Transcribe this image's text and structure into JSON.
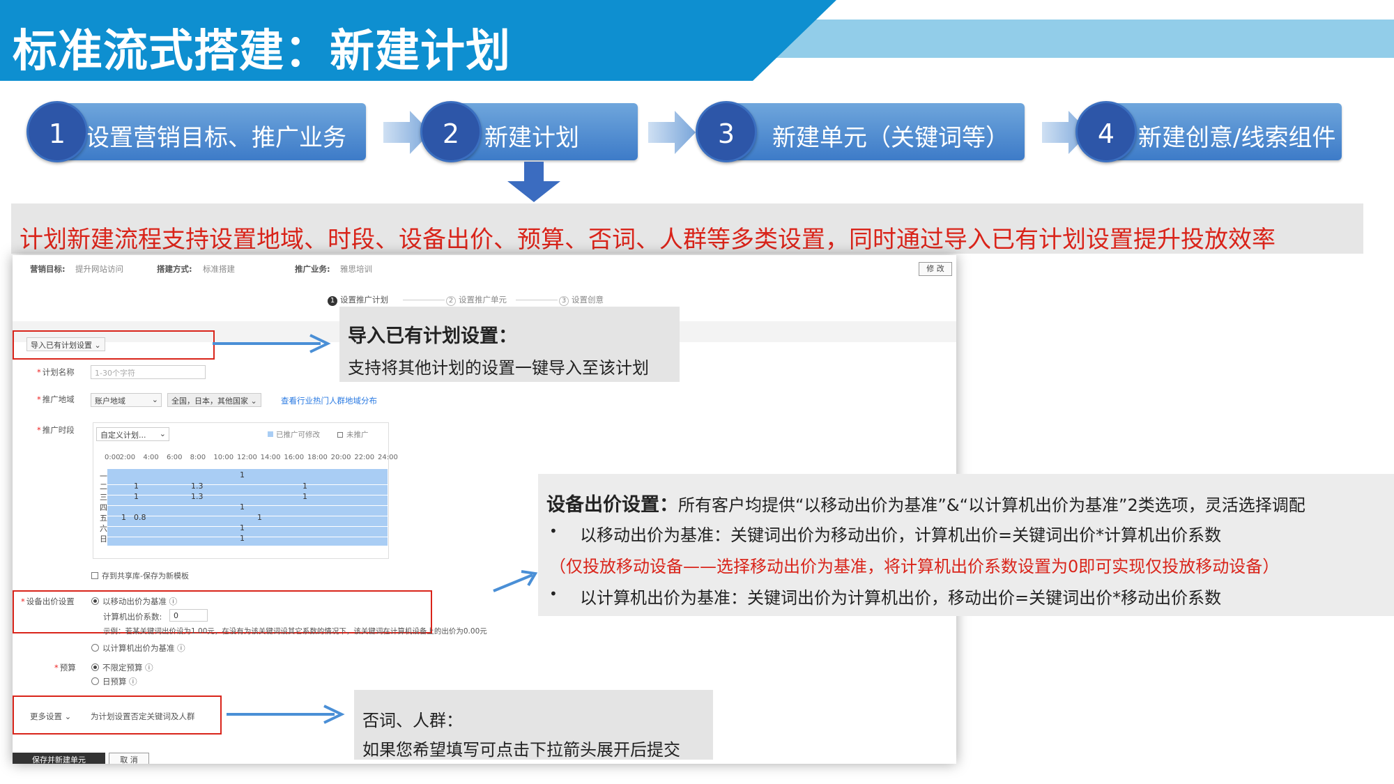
{
  "header": {
    "title": "标准流式搭建：新建计划"
  },
  "steps": [
    {
      "number": "1",
      "label": "设置营销目标、推广业务"
    },
    {
      "number": "2",
      "label": "新建计划"
    },
    {
      "number": "3",
      "label": "新建单元（关键词等）"
    },
    {
      "number": "4",
      "label": "新建创意/线索组件"
    }
  ],
  "summary": "计划新建流程支持设置地域、时段、设备出价、预算、否词、人群等多类设置，同时通过导入已有计划设置提升投放效率",
  "screenshot": {
    "marketing_goal_label": "营销目标:",
    "marketing_goal_value": "提升网站访问",
    "build_mode_label": "搭建方式:",
    "build_mode_value": "标准搭建",
    "business_label": "推广业务:",
    "business_value": "雅思培训",
    "modify_button": "修 改",
    "wizard": [
      "设置推广计划",
      "设置推广单元",
      "设置创意"
    ],
    "wizard_numbers": [
      "1",
      "2",
      "3"
    ],
    "import_button": "导入已有计划设置",
    "plan_name_label": "计划名称",
    "plan_name_placeholder": "1-30个字符",
    "region_label": "推广地域",
    "region_select": "账户地域",
    "region_value": "全国，日本，其他国家",
    "region_link": "查看行业热门人群地域分布",
    "time_label": "推广时段",
    "time_select": "自定义计划...",
    "legend_editable": "已推广可修改",
    "legend_not": "未推广",
    "hours": [
      "0:00",
      "2:00",
      "4:00",
      "6:00",
      "8:00",
      "10:00",
      "12:00",
      "14:00",
      "16:00",
      "18:00",
      "20:00",
      "22:00",
      "24:00"
    ],
    "days": [
      "一",
      "二",
      "三",
      "四",
      "五",
      "六",
      "日"
    ],
    "grid_values": [
      "1",
      "1",
      "1.3",
      "1",
      "1",
      "1.3",
      "1",
      "1",
      "1",
      "0.8",
      "1",
      "1",
      "1"
    ],
    "save_template": "存到共享库-保存为新模板",
    "device_label": "设备出价设置",
    "device_opt_mobile": "以移动出价为基准",
    "pc_coef_label": "计算机出价系数:",
    "pc_coef_value": "0",
    "device_example": "示例：若某关键词出价设为1.00元，在没有为该关键词设其它系数的情况下，该关键词在计算机设备上的出价为0.00元",
    "device_opt_pc": "以计算机出价为基准",
    "budget_label": "预算",
    "budget_opt_unlimited": "不限定预算",
    "budget_opt_daily": "日预算",
    "more_label": "更多设置",
    "more_desc": "为计划设置否定关键词及人群",
    "save_new_unit": "保存并新建单元",
    "cancel": "取 消"
  },
  "callouts": {
    "import": {
      "title": "导入已有计划设置：",
      "text": "支持将其他计划的设置一键导入至该计划"
    },
    "device": {
      "title": "设备出价设置：",
      "title_rest": "所有客户均提供“以移动出价为基准”&“以计算机出价为基准”2类选项，灵活选择调配",
      "bullet1": "以移动出价为基准：关键词出价为移动出价，计算机出价=关键词出价*计算机出价系数",
      "red_note": "（仅投放移动设备——选择移动出价为基准，将计算机出价系数设置为0即可实现仅投放移动设备）",
      "bullet2": "以计算机出价为基准：关键词出价为计算机出价，移动出价=关键词出价*移动出价系数",
      "bullet_char": "•"
    },
    "negative": {
      "title": "否词、人群：",
      "text": "如果您希望填写可点击下拉箭头展开后提交"
    }
  },
  "colors": {
    "banner": "#0e8fd0",
    "banner_light": "#92cde9",
    "step": "#4a86cf",
    "step_circle": "#2d56a8",
    "accent_red": "#d9241a",
    "arrow_blue": "#4a8fd6"
  }
}
